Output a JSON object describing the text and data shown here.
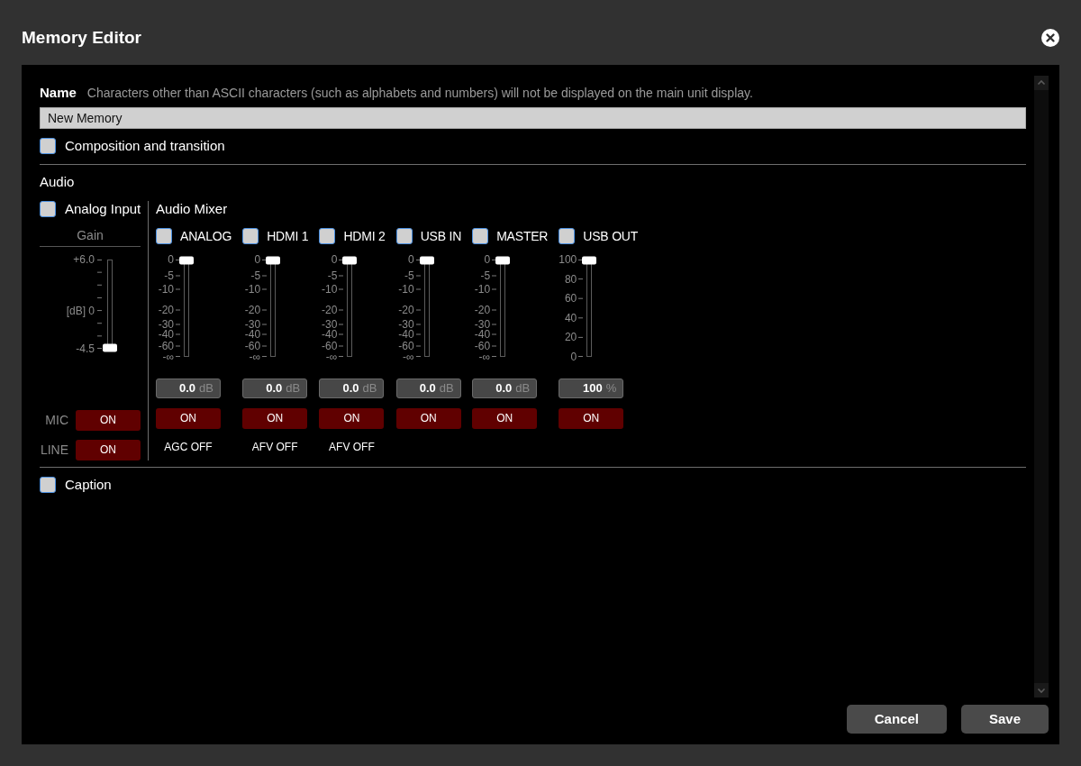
{
  "window": {
    "title": "Memory Editor"
  },
  "name": {
    "label": "Name",
    "hint": "Characters other than ASCII characters (such as alphabets and numbers) will not be displayed on the main unit display.",
    "value": "New Memory"
  },
  "composition": {
    "label": "Composition and transition",
    "checked": false
  },
  "audio": {
    "title": "Audio",
    "analog_input": {
      "label": "Analog Input",
      "checked": false,
      "gain": {
        "label": "Gain",
        "ticks": [
          "+6.0",
          "[dB] 0",
          "-4.5"
        ],
        "level": 0
      },
      "switches": [
        {
          "label": "MIC",
          "button": "ON",
          "on": true
        },
        {
          "label": "LINE",
          "button": "ON",
          "on": true
        }
      ]
    },
    "mixer": {
      "title": "Audio Mixer",
      "channels": [
        {
          "name": "ANALOG",
          "checked": false,
          "kind": "db",
          "ticks": [
            "0",
            "-5",
            "-10",
            "-20",
            "-30",
            "-40",
            "-60",
            "-∞"
          ],
          "level": 1,
          "value": "0.0",
          "unit": "dB",
          "button": "ON",
          "on": true,
          "footer": "AGC OFF"
        },
        {
          "name": "HDMI 1",
          "checked": false,
          "kind": "db",
          "ticks": [
            "0",
            "-5",
            "-10",
            "-20",
            "-30",
            "-40",
            "-60",
            "-∞"
          ],
          "level": 1,
          "value": "0.0",
          "unit": "dB",
          "button": "ON",
          "on": true,
          "footer": "AFV OFF"
        },
        {
          "name": "HDMI 2",
          "checked": false,
          "kind": "db",
          "ticks": [
            "0",
            "-5",
            "-10",
            "-20",
            "-30",
            "-40",
            "-60",
            "-∞"
          ],
          "level": 1,
          "value": "0.0",
          "unit": "dB",
          "button": "ON",
          "on": true,
          "footer": "AFV OFF"
        },
        {
          "name": "USB IN",
          "checked": false,
          "kind": "db",
          "ticks": [
            "0",
            "-5",
            "-10",
            "-20",
            "-30",
            "-40",
            "-60",
            "-∞"
          ],
          "level": 1,
          "value": "0.0",
          "unit": "dB",
          "button": "ON",
          "on": true
        },
        {
          "name": "MASTER",
          "checked": false,
          "kind": "db",
          "ticks": [
            "0",
            "-5",
            "-10",
            "-20",
            "-30",
            "-40",
            "-60",
            "-∞"
          ],
          "level": 1,
          "value": "0.0",
          "unit": "dB",
          "button": "ON",
          "on": true
        },
        {
          "name": "USB OUT",
          "checked": false,
          "kind": "percent",
          "ticks": [
            "100",
            "80",
            "60",
            "40",
            "20",
            "0"
          ],
          "level": 1,
          "value": "100",
          "unit": "%",
          "button": "ON",
          "on": true
        }
      ]
    }
  },
  "caption": {
    "label": "Caption",
    "checked": false
  },
  "buttons": [
    {
      "label": "Cancel"
    },
    {
      "label": "Save"
    }
  ]
}
